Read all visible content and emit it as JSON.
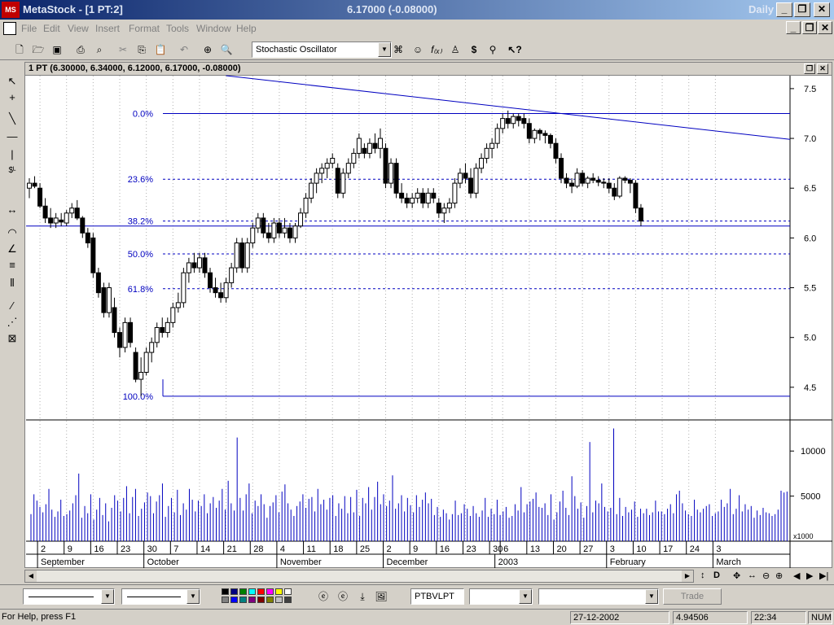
{
  "window": {
    "app_name": "MetaStock - [1 PT:2]",
    "price_readout": "6.17000 (-0.08000)",
    "periodicity": "Daily",
    "min_label": "_",
    "restore_label": "❐",
    "close_label": "✕"
  },
  "menu": [
    "File",
    "Edit",
    "View",
    "Insert",
    "Format",
    "Tools",
    "Window",
    "Help"
  ],
  "toolbar": {
    "indicator_select": "Stochastic Oscillator"
  },
  "chart_window": {
    "caption": "1 PT (6.30000, 6.34000, 6.12000, 6.17000, -0.08000)"
  },
  "bottom_toolbar": {
    "symbol": "PTBVLPT",
    "trade_label": "Trade"
  },
  "colors": {
    "palette": [
      "#000000",
      "#000080",
      "#008000",
      "#00ffff",
      "#ff0000",
      "#ff00ff",
      "#ffff00",
      "#ffffff",
      "#808080",
      "#0000ff",
      "#008080",
      "#800080",
      "#800000",
      "#808000",
      "#c0c0c0",
      "#404040"
    ]
  },
  "status": {
    "help": "For Help, press F1",
    "date": "27-12-2002",
    "value": "4.94506",
    "time": "22:34",
    "num": "NUM"
  },
  "chart_data": {
    "type": "candlestick",
    "price_axis": {
      "ylim": [
        4.18,
        7.63
      ],
      "ticks": [
        "7.5",
        "7.0",
        "6.5",
        "6.0",
        "5.5",
        "5.0",
        "4.5"
      ]
    },
    "fibonacci": [
      {
        "label": "0.0%",
        "price": 7.25,
        "style": "solid"
      },
      {
        "label": "23.6%",
        "price": 6.59,
        "style": "dashed"
      },
      {
        "label": "38.2%",
        "price": 6.17,
        "style": "dashed"
      },
      {
        "label": "50.0%",
        "price": 5.84,
        "style": "dashed"
      },
      {
        "label": "61.8%",
        "price": 5.49,
        "style": "dashed"
      },
      {
        "label": "100.0%",
        "price": 4.41,
        "style": "solid"
      }
    ],
    "horizontal_line": {
      "price": 6.12
    },
    "trendline": [
      {
        "bar": 37,
        "price": 7.63
      },
      {
        "bar": 107,
        "price": 6.99
      }
    ],
    "candles": [
      {
        "o": 6.5,
        "h": 6.6,
        "l": 6.4,
        "c": 6.55
      },
      {
        "o": 6.55,
        "h": 6.62,
        "l": 6.5,
        "c": 6.52
      },
      {
        "o": 6.5,
        "h": 6.55,
        "l": 6.3,
        "c": 6.32
      },
      {
        "o": 6.32,
        "h": 6.4,
        "l": 6.15,
        "c": 6.2
      },
      {
        "o": 6.2,
        "h": 6.3,
        "l": 6.1,
        "c": 6.15
      },
      {
        "o": 6.15,
        "h": 6.25,
        "l": 6.1,
        "c": 6.2
      },
      {
        "o": 6.18,
        "h": 6.25,
        "l": 6.12,
        "c": 6.16
      },
      {
        "o": 6.15,
        "h": 6.28,
        "l": 6.12,
        "c": 6.25
      },
      {
        "o": 6.25,
        "h": 6.35,
        "l": 6.2,
        "c": 6.3
      },
      {
        "o": 6.3,
        "h": 6.38,
        "l": 6.18,
        "c": 6.2
      },
      {
        "o": 6.2,
        "h": 6.22,
        "l": 6.0,
        "c": 6.05
      },
      {
        "o": 6.05,
        "h": 6.1,
        "l": 5.9,
        "c": 5.95
      },
      {
        "o": 6.0,
        "h": 6.05,
        "l": 5.6,
        "c": 5.65
      },
      {
        "o": 5.65,
        "h": 5.7,
        "l": 5.4,
        "c": 5.45
      },
      {
        "o": 5.5,
        "h": 5.55,
        "l": 5.2,
        "c": 5.25
      },
      {
        "o": 5.25,
        "h": 5.55,
        "l": 5.2,
        "c": 5.5
      },
      {
        "o": 5.3,
        "h": 5.4,
        "l": 5.0,
        "c": 5.05
      },
      {
        "o": 5.05,
        "h": 5.1,
        "l": 4.8,
        "c": 4.9
      },
      {
        "o": 4.9,
        "h": 5.2,
        "l": 4.85,
        "c": 5.15
      },
      {
        "o": 5.15,
        "h": 5.2,
        "l": 4.9,
        "c": 4.95
      },
      {
        "o": 4.85,
        "h": 4.9,
        "l": 4.55,
        "c": 4.58
      },
      {
        "o": 4.58,
        "h": 4.8,
        "l": 4.41,
        "c": 4.65
      },
      {
        "o": 4.65,
        "h": 4.9,
        "l": 4.62,
        "c": 4.85
      },
      {
        "o": 4.85,
        "h": 5.0,
        "l": 4.75,
        "c": 4.95
      },
      {
        "o": 4.95,
        "h": 5.15,
        "l": 4.9,
        "c": 5.1
      },
      {
        "o": 5.1,
        "h": 5.2,
        "l": 5.0,
        "c": 5.05
      },
      {
        "o": 5.05,
        "h": 5.2,
        "l": 5.0,
        "c": 5.15
      },
      {
        "o": 5.15,
        "h": 5.35,
        "l": 5.1,
        "c": 5.3
      },
      {
        "o": 5.3,
        "h": 5.45,
        "l": 5.25,
        "c": 5.35
      },
      {
        "o": 5.35,
        "h": 5.7,
        "l": 5.3,
        "c": 5.65
      },
      {
        "o": 5.65,
        "h": 5.8,
        "l": 5.55,
        "c": 5.75
      },
      {
        "o": 5.75,
        "h": 5.85,
        "l": 5.65,
        "c": 5.7
      },
      {
        "o": 5.7,
        "h": 5.85,
        "l": 5.65,
        "c": 5.8
      },
      {
        "o": 5.8,
        "h": 5.85,
        "l": 5.6,
        "c": 5.65
      },
      {
        "o": 5.65,
        "h": 5.7,
        "l": 5.45,
        "c": 5.5
      },
      {
        "o": 5.5,
        "h": 5.6,
        "l": 5.4,
        "c": 5.45
      },
      {
        "o": 5.45,
        "h": 5.55,
        "l": 5.35,
        "c": 5.4
      },
      {
        "o": 5.4,
        "h": 5.6,
        "l": 5.35,
        "c": 5.55
      },
      {
        "o": 5.55,
        "h": 5.75,
        "l": 5.5,
        "c": 5.7
      },
      {
        "o": 5.7,
        "h": 6.0,
        "l": 5.65,
        "c": 5.95
      },
      {
        "o": 5.95,
        "h": 6.0,
        "l": 5.65,
        "c": 5.7
      },
      {
        "o": 5.7,
        "h": 6.0,
        "l": 5.65,
        "c": 5.95
      },
      {
        "o": 5.95,
        "h": 6.15,
        "l": 5.9,
        "c": 6.1
      },
      {
        "o": 6.1,
        "h": 6.25,
        "l": 6.05,
        "c": 6.2
      },
      {
        "o": 6.2,
        "h": 6.25,
        "l": 6.0,
        "c": 6.05
      },
      {
        "o": 6.05,
        "h": 6.15,
        "l": 5.95,
        "c": 6.0
      },
      {
        "o": 6.0,
        "h": 6.2,
        "l": 5.95,
        "c": 6.15
      },
      {
        "o": 6.15,
        "h": 6.2,
        "l": 6.0,
        "c": 6.05
      },
      {
        "o": 6.05,
        "h": 6.2,
        "l": 6.0,
        "c": 6.1
      },
      {
        "o": 6.1,
        "h": 6.15,
        "l": 5.95,
        "c": 6.0
      },
      {
        "o": 6.0,
        "h": 6.15,
        "l": 5.95,
        "c": 6.12
      },
      {
        "o": 6.12,
        "h": 6.3,
        "l": 6.1,
        "c": 6.25
      },
      {
        "o": 6.25,
        "h": 6.45,
        "l": 6.2,
        "c": 6.4
      },
      {
        "o": 6.4,
        "h": 6.6,
        "l": 6.35,
        "c": 6.55
      },
      {
        "o": 6.55,
        "h": 6.7,
        "l": 6.45,
        "c": 6.65
      },
      {
        "o": 6.65,
        "h": 6.75,
        "l": 6.55,
        "c": 6.7
      },
      {
        "o": 6.7,
        "h": 6.8,
        "l": 6.6,
        "c": 6.75
      },
      {
        "o": 6.75,
        "h": 6.85,
        "l": 6.7,
        "c": 6.8
      },
      {
        "o": 6.7,
        "h": 6.75,
        "l": 6.4,
        "c": 6.45
      },
      {
        "o": 6.45,
        "h": 6.7,
        "l": 6.4,
        "c": 6.65
      },
      {
        "o": 6.65,
        "h": 6.8,
        "l": 6.6,
        "c": 6.75
      },
      {
        "o": 6.75,
        "h": 6.9,
        "l": 6.7,
        "c": 6.85
      },
      {
        "o": 6.85,
        "h": 7.05,
        "l": 6.8,
        "c": 7.0
      },
      {
        "o": 6.9,
        "h": 6.95,
        "l": 6.8,
        "c": 6.85
      },
      {
        "o": 6.85,
        "h": 7.0,
        "l": 6.8,
        "c": 6.95
      },
      {
        "o": 6.95,
        "h": 7.05,
        "l": 6.85,
        "c": 6.9
      },
      {
        "o": 6.9,
        "h": 7.1,
        "l": 6.8,
        "c": 7.0
      },
      {
        "o": 6.9,
        "h": 6.95,
        "l": 6.5,
        "c": 6.55
      },
      {
        "o": 6.55,
        "h": 6.8,
        "l": 6.5,
        "c": 6.75
      },
      {
        "o": 6.75,
        "h": 6.8,
        "l": 6.4,
        "c": 6.45
      },
      {
        "o": 6.45,
        "h": 6.55,
        "l": 6.35,
        "c": 6.4
      },
      {
        "o": 6.4,
        "h": 6.45,
        "l": 6.3,
        "c": 6.35
      },
      {
        "o": 6.35,
        "h": 6.45,
        "l": 6.3,
        "c": 6.4
      },
      {
        "o": 6.4,
        "h": 6.5,
        "l": 6.35,
        "c": 6.45
      },
      {
        "o": 6.45,
        "h": 6.5,
        "l": 6.3,
        "c": 6.35
      },
      {
        "o": 6.35,
        "h": 6.5,
        "l": 6.3,
        "c": 6.45
      },
      {
        "o": 6.45,
        "h": 6.5,
        "l": 6.35,
        "c": 6.4
      },
      {
        "o": 6.35,
        "h": 6.4,
        "l": 6.2,
        "c": 6.25
      },
      {
        "o": 6.25,
        "h": 6.35,
        "l": 6.15,
        "c": 6.3
      },
      {
        "o": 6.3,
        "h": 6.4,
        "l": 6.25,
        "c": 6.35
      },
      {
        "o": 6.35,
        "h": 6.6,
        "l": 6.3,
        "c": 6.55
      },
      {
        "o": 6.55,
        "h": 6.7,
        "l": 6.5,
        "c": 6.65
      },
      {
        "o": 6.65,
        "h": 6.75,
        "l": 6.55,
        "c": 6.6
      },
      {
        "o": 6.6,
        "h": 6.7,
        "l": 6.4,
        "c": 6.45
      },
      {
        "o": 6.45,
        "h": 6.75,
        "l": 6.4,
        "c": 6.7
      },
      {
        "o": 6.7,
        "h": 6.85,
        "l": 6.65,
        "c": 6.8
      },
      {
        "o": 6.8,
        "h": 6.95,
        "l": 6.75,
        "c": 6.9
      },
      {
        "o": 6.9,
        "h": 7.0,
        "l": 6.8,
        "c": 6.95
      },
      {
        "o": 6.95,
        "h": 7.15,
        "l": 6.9,
        "c": 7.1
      },
      {
        "o": 7.1,
        "h": 7.25,
        "l": 7.05,
        "c": 7.2
      },
      {
        "o": 7.2,
        "h": 7.28,
        "l": 7.1,
        "c": 7.15
      },
      {
        "o": 7.15,
        "h": 7.25,
        "l": 7.1,
        "c": 7.22
      },
      {
        "o": 7.22,
        "h": 7.25,
        "l": 7.12,
        "c": 7.18
      },
      {
        "o": 7.2,
        "h": 7.25,
        "l": 7.1,
        "c": 7.15
      },
      {
        "o": 7.15,
        "h": 7.2,
        "l": 6.95,
        "c": 7.0
      },
      {
        "o": 7.0,
        "h": 7.1,
        "l": 6.95,
        "c": 7.08
      },
      {
        "o": 7.08,
        "h": 7.1,
        "l": 6.98,
        "c": 7.05
      },
      {
        "o": 7.05,
        "h": 7.08,
        "l": 6.95,
        "c": 7.03
      },
      {
        "o": 7.03,
        "h": 7.05,
        "l": 6.9,
        "c": 6.95
      },
      {
        "o": 6.95,
        "h": 7.0,
        "l": 6.75,
        "c": 6.8
      },
      {
        "o": 6.8,
        "h": 6.85,
        "l": 6.55,
        "c": 6.6
      },
      {
        "o": 6.6,
        "h": 6.65,
        "l": 6.5,
        "c": 6.55
      },
      {
        "o": 6.55,
        "h": 6.6,
        "l": 6.45,
        "c": 6.52
      },
      {
        "o": 6.52,
        "h": 6.7,
        "l": 6.5,
        "c": 6.65
      },
      {
        "o": 6.65,
        "h": 6.68,
        "l": 6.52,
        "c": 6.55
      },
      {
        "o": 6.55,
        "h": 6.62,
        "l": 6.5,
        "c": 6.6
      },
      {
        "o": 6.6,
        "h": 6.65,
        "l": 6.55,
        "c": 6.58
      },
      {
        "o": 6.58,
        "h": 6.62,
        "l": 6.52,
        "c": 6.56
      },
      {
        "o": 6.56,
        "h": 6.6,
        "l": 6.5,
        "c": 6.55
      },
      {
        "o": 6.55,
        "h": 6.6,
        "l": 6.45,
        "c": 6.5
      },
      {
        "o": 6.5,
        "h": 6.55,
        "l": 6.38,
        "c": 6.42
      },
      {
        "o": 6.42,
        "h": 6.62,
        "l": 6.4,
        "c": 6.6
      },
      {
        "o": 6.6,
        "h": 6.62,
        "l": 6.55,
        "c": 6.58
      },
      {
        "o": 6.58,
        "h": 6.6,
        "l": 6.45,
        "c": 6.55
      },
      {
        "o": 6.55,
        "h": 6.58,
        "l": 6.25,
        "c": 6.3
      },
      {
        "o": 6.3,
        "h": 6.34,
        "l": 6.12,
        "c": 6.17
      }
    ],
    "volume": {
      "ticks": [
        "10000",
        "5000"
      ],
      "multiplier_label": "x1000",
      "ylim": [
        0,
        13000
      ],
      "values": [
        3000,
        5200,
        4500,
        3800,
        3200,
        4100,
        5800,
        3500,
        2700,
        3300,
        4600,
        2800,
        3000,
        3400,
        4200,
        5100,
        7500,
        2600,
        3900,
        3100,
        5200,
        2400,
        3500,
        4800,
        2900,
        4200,
        2200,
        3700,
        5100,
        4500,
        3300,
        4800,
        6100,
        3100,
        4900,
        5800,
        2800,
        3600,
        4300,
        5400,
        5000,
        3100,
        4400,
        5100,
        6400,
        2700,
        3900,
        4800,
        3200,
        5700,
        2900,
        4200,
        3500,
        5800,
        4600,
        3300,
        4500,
        3900,
        5200,
        3100,
        4200,
        4900,
        3700,
        4500,
        5800,
        3500,
        6700,
        4200,
        3400,
        11500,
        4800,
        3400,
        5200,
        6400,
        3100,
        4500,
        3900,
        5200,
        4100,
        2600,
        3900,
        4300,
        5100,
        3200,
        5500,
        6300,
        4200,
        3500,
        2800,
        3900,
        4400,
        5200,
        3700,
        4700,
        4900,
        3300,
        5800,
        4100,
        4600,
        3500,
        4800,
        5100,
        2800,
        4200,
        3600,
        5000,
        3100,
        4900,
        3200,
        5700,
        2800,
        4800,
        4200,
        6000,
        3500,
        4900,
        6600,
        4100,
        5200,
        3900,
        4500,
        7300,
        3600,
        4200,
        5100,
        3300,
        4800,
        4000,
        3200,
        5100,
        3800,
        4600,
        5400,
        4200,
        4700,
        2900,
        3800,
        2700,
        3500,
        3100,
        2400,
        3000,
        4500,
        2900,
        3100,
        4100,
        3600,
        2800,
        3900,
        3100,
        2700,
        3400,
        4800,
        2700,
        3600,
        3000,
        4600,
        2900,
        3300,
        3800,
        2600,
        2800,
        4100,
        3400,
        6000,
        3200,
        4100,
        4400,
        4700,
        5400,
        3800,
        3700,
        4200,
        2900,
        5200,
        2400,
        3200,
        4400,
        5600,
        3700,
        2900,
        7200,
        5000,
        3600,
        4300,
        2600,
        3900,
        11000,
        3200,
        4500,
        4200,
        6400,
        3800,
        3300,
        3700,
        12500,
        3000,
        4800,
        2800,
        3800,
        3200,
        3500,
        4400,
        2700,
        3600,
        3100,
        3600,
        2900,
        3200,
        4500,
        3300,
        3300,
        3000,
        3600,
        4100,
        3100,
        5200,
        5600,
        4200,
        3400,
        3000,
        2800,
        4600,
        3500,
        3200,
        3600,
        3900,
        4100,
        2800,
        3100,
        3300,
        4600,
        3800,
        4200,
        5800,
        3000,
        3600,
        5100,
        3300,
        4100,
        3500,
        3900,
        2600,
        3400,
        2900,
        3700,
        3200,
        3100,
        2800,
        3000,
        3500,
        5600,
        5400,
        5500
      ]
    },
    "x_axis": {
      "day_labels": [
        {
          "bar": 2,
          "label": "2"
        },
        {
          "bar": 7,
          "label": "9"
        },
        {
          "bar": 12,
          "label": "16"
        },
        {
          "bar": 17,
          "label": "23"
        },
        {
          "bar": 22,
          "label": "30"
        },
        {
          "bar": 27,
          "label": "7"
        },
        {
          "bar": 32,
          "label": "14"
        },
        {
          "bar": 37,
          "label": "21"
        },
        {
          "bar": 42,
          "label": "28"
        },
        {
          "bar": 47,
          "label": "4"
        },
        {
          "bar": 52,
          "label": "11"
        },
        {
          "bar": 57,
          "label": "18"
        },
        {
          "bar": 62,
          "label": "25"
        },
        {
          "bar": 67,
          "label": "2"
        },
        {
          "bar": 72,
          "label": "9"
        },
        {
          "bar": 77,
          "label": "16"
        },
        {
          "bar": 82,
          "label": "23"
        },
        {
          "bar": 87,
          "label": "30"
        },
        {
          "bar": 89,
          "label": "6"
        },
        {
          "bar": 94,
          "label": "13"
        },
        {
          "bar": 99,
          "label": "20"
        },
        {
          "bar": 104,
          "label": "27"
        },
        {
          "bar": 109,
          "label": "3"
        },
        {
          "bar": 114,
          "label": "10"
        },
        {
          "bar": 119,
          "label": "17"
        },
        {
          "bar": 124,
          "label": "24"
        },
        {
          "bar": 129,
          "label": "3"
        }
      ],
      "month_labels": [
        {
          "bar": 2,
          "label": "September"
        },
        {
          "bar": 22,
          "label": "October"
        },
        {
          "bar": 47,
          "label": "November"
        },
        {
          "bar": 67,
          "label": "December"
        },
        {
          "bar": 88,
          "label": "2003"
        },
        {
          "bar": 109,
          "label": "February"
        },
        {
          "bar": 129,
          "label": "March"
        }
      ],
      "total_bars": 131
    }
  }
}
